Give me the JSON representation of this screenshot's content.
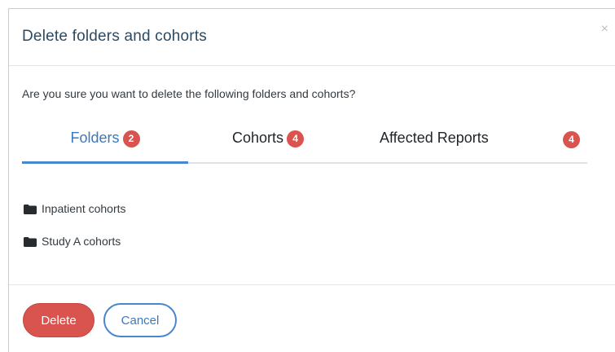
{
  "dialog": {
    "title": "Delete folders and cohorts",
    "close_symbol": "×",
    "prompt": "Are you sure you want to delete the following folders and cohorts?"
  },
  "tabs": [
    {
      "label": "Folders",
      "count": "2",
      "active": true
    },
    {
      "label": "Cohorts",
      "count": "4",
      "active": false
    },
    {
      "label": "Affected Reports",
      "count": "4",
      "active": false
    }
  ],
  "folders": [
    {
      "name": "Inpatient cohorts",
      "icon": "folder-icon"
    },
    {
      "name": "Study A cohorts",
      "icon": "folder-icon"
    }
  ],
  "footer": {
    "delete_label": "Delete",
    "cancel_label": "Cancel"
  },
  "colors": {
    "accent": "#3a78c3",
    "danger": "#d9534f",
    "title": "#2c4a63"
  }
}
